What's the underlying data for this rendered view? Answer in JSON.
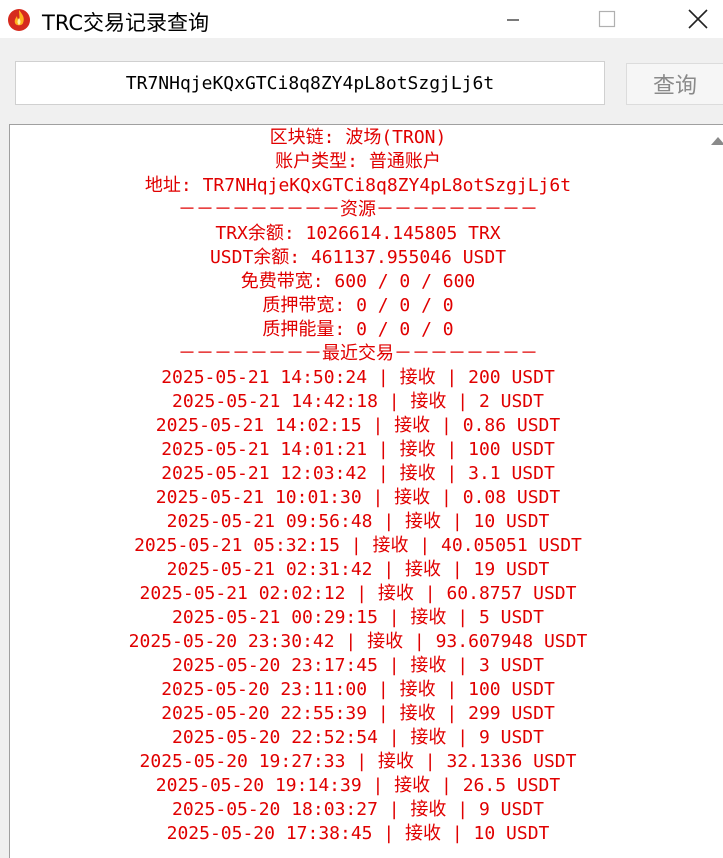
{
  "window": {
    "title": "TRC交易记录查询",
    "icon": "flame-app-icon"
  },
  "toolbar": {
    "address_value": "TR7NHqjeKQxGTCi8q8ZY4pL8otSzgjLj6t",
    "query_label": "查询"
  },
  "result": {
    "chain": "区块链: 波场(TRON)",
    "account_type": "账户类型: 普通账户",
    "address": "地址: TR7NHqjeKQxGTCi8q8ZY4pL8otSzgjLj6t",
    "resources_header": "－－－－－－－－－资源－－－－－－－－－",
    "trx_balance": "TRX余额: 1026614.145805 TRX",
    "usdt_balance": "USDT余额: 461137.955046 USDT",
    "free_bandwidth": "免费带宽: 600 / 0 / 600",
    "staked_bandwidth": "质押带宽: 0 / 0 / 0",
    "staked_energy": "质押能量: 0 / 0 / 0",
    "recent_header": "－－－－－－－－最近交易－－－－－－－－",
    "transactions": [
      "2025-05-21 14:50:24 | 接收 | 200 USDT",
      "2025-05-21 14:42:18 | 接收 | 2 USDT",
      "2025-05-21 14:02:15 | 接收 | 0.86 USDT",
      "2025-05-21 14:01:21 | 接收 | 100 USDT",
      "2025-05-21 12:03:42 | 接收 | 3.1 USDT",
      "2025-05-21 10:01:30 | 接收 | 0.08 USDT",
      "2025-05-21 09:56:48 | 接收 | 10 USDT",
      "2025-05-21 05:32:15 | 接收 | 40.05051 USDT",
      "2025-05-21 02:31:42 | 接收 | 19 USDT",
      "2025-05-21 02:02:12 | 接收 | 60.8757 USDT",
      "2025-05-21 00:29:15 | 接收 | 5 USDT",
      "2025-05-20 23:30:42 | 接收 | 93.607948 USDT",
      "2025-05-20 23:17:45 | 接收 | 3 USDT",
      "2025-05-20 23:11:00 | 接收 | 100 USDT",
      "2025-05-20 22:55:39 | 接收 | 299 USDT",
      "2025-05-20 22:52:54 | 接收 | 9 USDT",
      "2025-05-20 19:27:33 | 接收 | 32.1336 USDT",
      "2025-05-20 19:14:39 | 接收 | 26.5 USDT",
      "2025-05-20 18:03:27 | 接收 | 9 USDT",
      "2025-05-20 17:38:45 | 接收 | 10 USDT"
    ]
  },
  "colors": {
    "result_text": "#e00000",
    "background": "#f0f0f0"
  }
}
